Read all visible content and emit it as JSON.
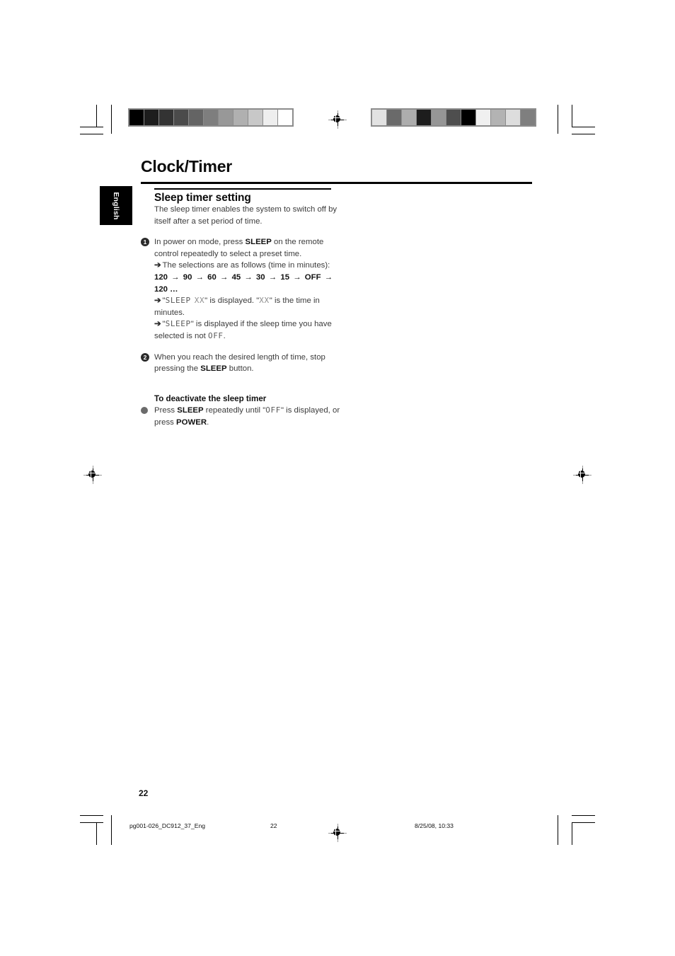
{
  "document": {
    "chapter_title": "Clock/Timer",
    "language_tab": "English",
    "page_number": "22"
  },
  "section": {
    "heading": "Sleep timer setting",
    "intro": "The sleep timer enables the system to switch off by itself after a set period of time."
  },
  "steps": [
    {
      "marker": "1",
      "text_before_bold": "In power on mode, press ",
      "bold": "SLEEP",
      "text_after_bold": " on the remote control repeatedly to select a preset time."
    },
    {
      "marker": "2",
      "text_before_bold": "When you reach the desired length of time, stop pressing the ",
      "bold": "SLEEP",
      "text_after_bold": " button."
    }
  ],
  "results": {
    "arrow_glyph": "➔",
    "r1": "The selections are as follows (time in minutes):",
    "sequence": {
      "items": [
        "120",
        "90",
        "60",
        "45",
        "30",
        "15",
        "OFF",
        "120"
      ],
      "separator": "→",
      "trailing": "…"
    },
    "r2_quote_open": "\"",
    "r2_lcd": "SLEEP",
    "r2_lcd_value": "XX",
    "r2_quote_close": "\"",
    "r2_mid": " is displayed. \"",
    "r2_lcd_value2": "XX",
    "r2_end": "\" is the time in minutes.",
    "r3_pre": "\"",
    "r3_lcd": "SLEEP",
    "r3_post": "\" is displayed if the sleep time you have selected is not ",
    "r3_lcd_off": "OFF",
    "r3_period": "."
  },
  "deactivate": {
    "heading": "To deactivate the sleep timer",
    "text_1": "Press ",
    "bold_1": "SLEEP",
    "text_2": " repeatedly until \"",
    "lcd_off": "OFF",
    "text_3": "\" is displayed, or press ",
    "bold_2": "POWER",
    "text_4": "."
  },
  "footer": {
    "filename": "pg001-026_DC912_37_Eng",
    "page": "22",
    "timestamp": "8/25/08, 10:33"
  },
  "print_marks": {
    "colorbar_left": [
      "#000000",
      "#1d1d1d",
      "#333333",
      "#4b4b4b",
      "#646464",
      "#7e7e7e",
      "#989898",
      "#b0b0b0",
      "#c8c8c8",
      "#eeeeee",
      "#ffffff"
    ],
    "colorbar_right": [
      "#e2e2e2",
      "#6a6a6a",
      "#adadad",
      "#1d1d1d",
      "#969696",
      "#4e4e4e",
      "#000000",
      "#f0f0f0",
      "#b3b3b3",
      "#dddddd",
      "#7f7f7f"
    ]
  }
}
